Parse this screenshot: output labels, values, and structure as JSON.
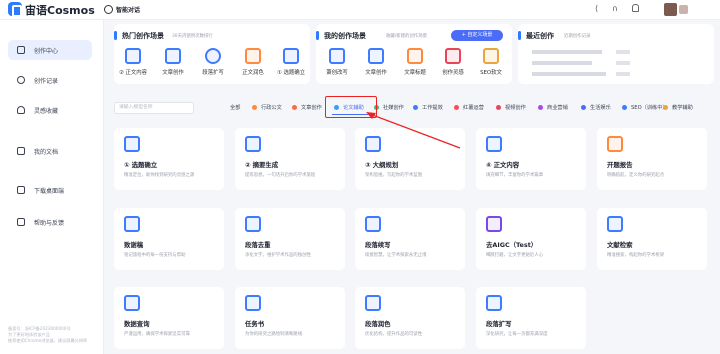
{
  "app": {
    "brand": "宙语Cosmos",
    "page_title": "智能对话",
    "brand_color": "#2f7bff",
    "accent": "#4a6cf7"
  },
  "topbar": {
    "icons": [
      "share-icon",
      "headset-icon",
      "bell-icon"
    ]
  },
  "sidebar": {
    "items": [
      {
        "label": "创作中心",
        "active": true,
        "icon": "grid-icon"
      },
      {
        "label": "创作记录",
        "icon": "history-icon"
      },
      {
        "label": "灵感收藏",
        "icon": "lightbulb-icon"
      },
      {
        "label": "我的文档",
        "icon": "book-icon"
      },
      {
        "label": "下载桌面端",
        "icon": "monitor-icon"
      },
      {
        "label": "帮助与反馈",
        "icon": "help-icon"
      }
    ],
    "footer": "备案号：浙ICP备2023000000号\n为了更好地体验该产品\n推荐使用Chrome浏览器，建议屏幕分辨率"
  },
  "hot": {
    "title": "热门创作场景",
    "subtitle": "30天内使用次数排行",
    "items": [
      {
        "label": "② 正文内容",
        "color": "#3d7bff"
      },
      {
        "label": "文章创作",
        "color": "#3d7bff"
      },
      {
        "label": "段落扩写",
        "color": "#3d7bff"
      },
      {
        "label": "正文润色",
        "color": "#ff8a3d"
      },
      {
        "label": "① 选题确立",
        "color": "#3d7bff"
      }
    ]
  },
  "mine": {
    "title": "我的创作场景",
    "subtitle": "收藏/新建的创作场景",
    "button": "+ 自定义场景",
    "items": [
      {
        "label": "萧创改写",
        "color": "#3d7bff"
      },
      {
        "label": "文章创作",
        "color": "#3d7bff"
      },
      {
        "label": "文章标题",
        "color": "#ff8a3d"
      },
      {
        "label": "创作灵感",
        "color": "#e8445a"
      },
      {
        "label": "SEO软文",
        "color": "#e8a63d"
      }
    ]
  },
  "recent": {
    "title": "最近创作",
    "subtitle": "近期创作记录"
  },
  "filters": {
    "search_placeholder": "请输入模型名称",
    "all": "全部",
    "categories": [
      {
        "label": "行政公文",
        "color": "#ff8a3d"
      },
      {
        "label": "文章创作",
        "color": "#ff6a3d"
      },
      {
        "label": "论文辅助",
        "color": "#3d9bff",
        "active": true
      },
      {
        "label": "社媒创作",
        "color": "#2fc46a"
      },
      {
        "label": "工作提效",
        "color": "#3d7bff"
      },
      {
        "label": "红薯运营",
        "color": "#ff4a5a"
      },
      {
        "label": "视频创作",
        "color": "#e8445a"
      },
      {
        "label": "商业营销",
        "color": "#a64ae8"
      },
      {
        "label": "生活娱乐",
        "color": "#4a6cf7"
      },
      {
        "label": "SEO（训练中）",
        "color": "#3d7bff"
      },
      {
        "label": "教学辅助",
        "color": "#e8a63d"
      }
    ]
  },
  "cards": [
    {
      "title": "① 选题确立",
      "desc": "精准定位，助你找到研究的灵感之源",
      "color": "#3d7bff"
    },
    {
      "title": "② 摘要生成",
      "desc": "提炼思想，一句话开启你的学术旅程",
      "color": "#3d7bff"
    },
    {
      "title": "③ 大纲规划",
      "desc": "架构思维，写起你的学术蓝图",
      "color": "#3d7bff"
    },
    {
      "title": "④ 正文内容",
      "desc": "填充细节，丰富你的学术篇章",
      "color": "#3d7bff"
    },
    {
      "title": "开题报告",
      "desc": "明确航航，定义你的研究起点",
      "color": "#ff8a3d"
    },
    {
      "title": "致谢稿",
      "desc": "铭记旅程中的每一份支持与帮助",
      "color": "#3d7bff"
    },
    {
      "title": "段落去重",
      "desc": "净化文字，维护学术作品的独创性",
      "color": "#3d7bff"
    },
    {
      "title": "段落续写",
      "desc": "续接智慧，让学术探索永无止境",
      "color": "#3d7bff"
    },
    {
      "title": "去AIGC（Test）",
      "desc": "细腻打磨，让文字更贴近人心",
      "color": "#7a4ae8"
    },
    {
      "title": "文献检索",
      "desc": "精准搜索，构起你的学术桥梁",
      "color": "#3d7bff"
    },
    {
      "title": "数据查询",
      "desc": "严谨运用，确保学术探索坚实可靠",
      "color": "#3d7bff"
    },
    {
      "title": "任务书",
      "desc": "为你的研究之路绘制清晰路线",
      "color": "#3d7bff"
    },
    {
      "title": "段落润色",
      "desc": "优化结构，提升作品的可读性",
      "color": "#3d7bff"
    },
    {
      "title": "段落扩写",
      "desc": "深化研究，让每一页都充满深度",
      "color": "#3d7bff"
    }
  ]
}
